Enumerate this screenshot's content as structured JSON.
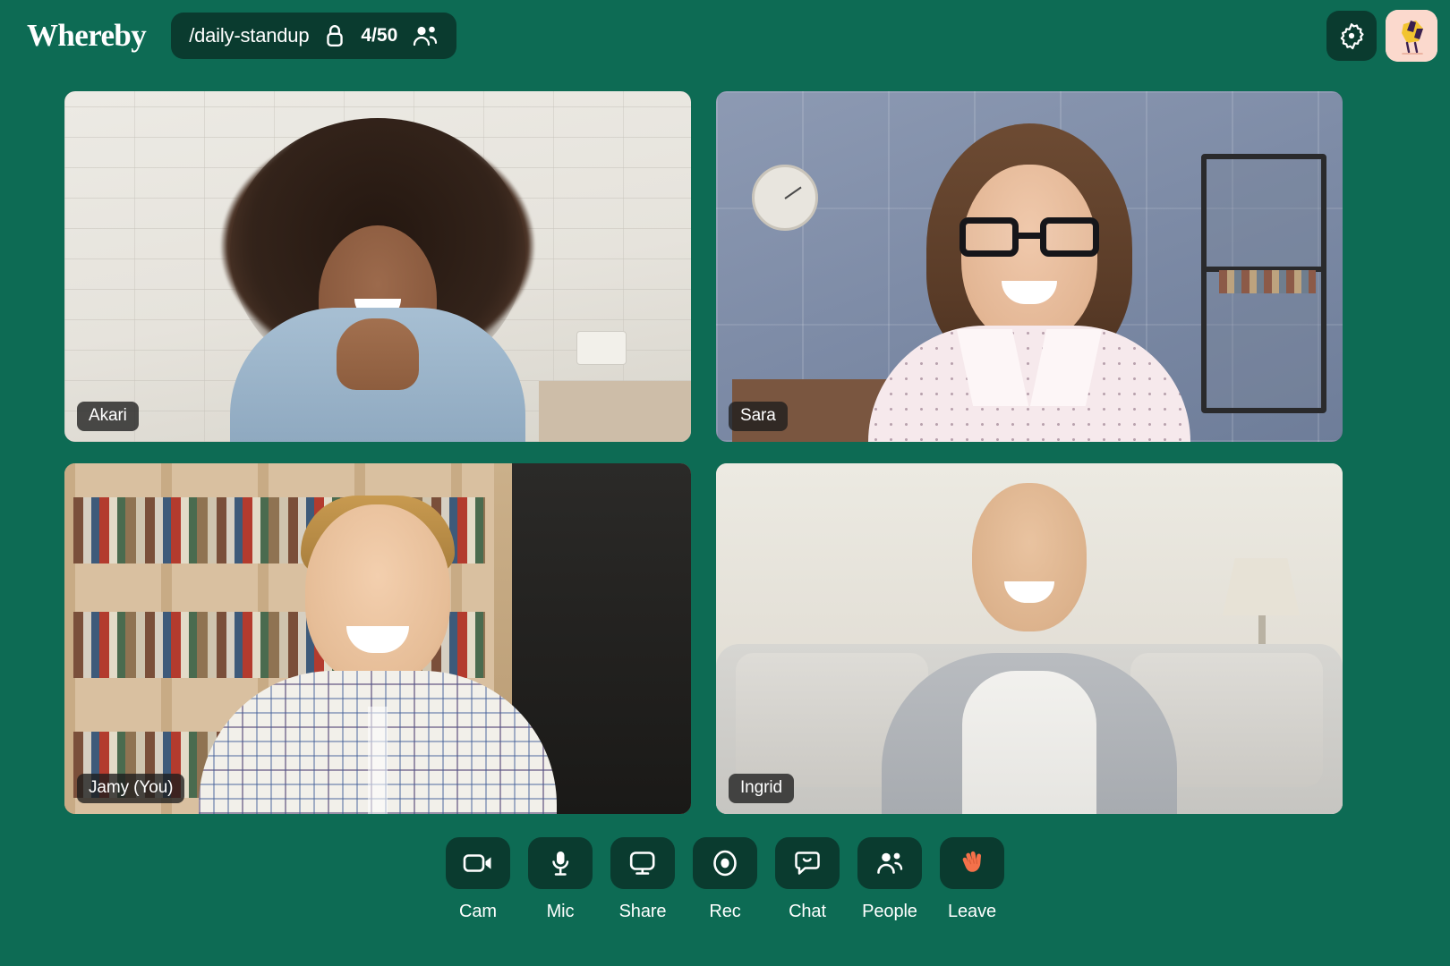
{
  "app": {
    "brand": "Whereby",
    "background_color": "#0d6b54",
    "surface_color": "#0a3b2f"
  },
  "header": {
    "room": {
      "name": "/daily-standup",
      "lock_icon": "lock-icon",
      "participant_count": "4/50",
      "people_icon": "people-icon"
    },
    "settings_icon": "gear-icon",
    "avatar": {
      "name": "user-avatar",
      "background_color": "#fbd9cd"
    }
  },
  "grid": {
    "tiles": [
      {
        "name": "Akari",
        "scene": "white-brick-wall"
      },
      {
        "name": "Sara",
        "scene": "blue-panel-wall"
      },
      {
        "name": "Jamy (You)",
        "scene": "bookshelf"
      },
      {
        "name": "Ingrid",
        "scene": "living-room-sofa"
      }
    ]
  },
  "toolbar": {
    "items": [
      {
        "label": "Cam",
        "icon": "camera-icon"
      },
      {
        "label": "Mic",
        "icon": "microphone-icon"
      },
      {
        "label": "Share",
        "icon": "screen-share-icon"
      },
      {
        "label": "Rec",
        "icon": "record-icon"
      },
      {
        "label": "Chat",
        "icon": "chat-bubble-icon"
      },
      {
        "label": "People",
        "icon": "people-icon"
      },
      {
        "label": "Leave",
        "icon": "waving-hand-icon"
      }
    ],
    "leave_icon_color": "#f4714a"
  }
}
